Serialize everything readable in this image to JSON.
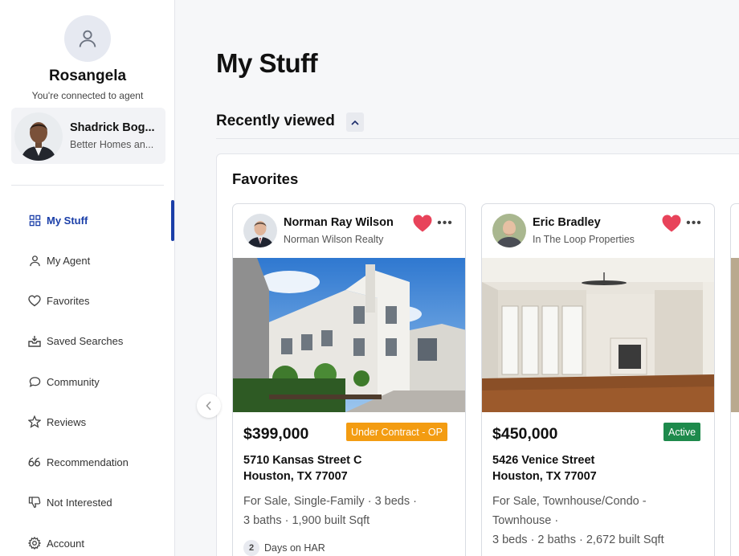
{
  "sidebar": {
    "user_name": "Rosangela",
    "connected_text": "You're connected to agent",
    "agent": {
      "name": "Shadrick Bog...",
      "company": "Better Homes an..."
    },
    "nav": [
      {
        "label": "My Stuff",
        "icon": "grid-icon",
        "active": true
      },
      {
        "label": "My Agent",
        "icon": "user-icon"
      },
      {
        "label": "Favorites",
        "icon": "heart-outline-icon"
      },
      {
        "label": "Saved Searches",
        "icon": "inbox-icon"
      },
      {
        "label": "Community",
        "icon": "chat-icon"
      },
      {
        "label": "Reviews",
        "icon": "star-icon"
      },
      {
        "label": "Recommendation",
        "icon": "quote-icon"
      },
      {
        "label": "Not Interested",
        "icon": "thumbs-down-icon"
      },
      {
        "label": "Account",
        "icon": "gear-icon"
      }
    ]
  },
  "main": {
    "page_title": "My Stuff",
    "recently_viewed_label": "Recently viewed",
    "favorites_title": "Favorites",
    "cards": [
      {
        "agent_name": "Norman Ray Wilson",
        "agent_company": "Norman Wilson Realty",
        "price": "$399,000",
        "status": "Under Contract - OP",
        "status_color": "#f39c12",
        "address_line1": "5710 Kansas Street C",
        "address_line2": "Houston, TX 77007",
        "details_line1": "For Sale, Single-Family  ·  3 beds  ·",
        "details_line2": "3 baths  ·  1,900 built Sqft",
        "days_on_har": "2",
        "days_label": "Days on HAR"
      },
      {
        "agent_name": "Eric Bradley",
        "agent_company": "In The Loop Properties",
        "price": "$450,000",
        "status": "Active",
        "status_color": "#1e8a4c",
        "address_line1": "5426 Venice Street",
        "address_line2": "Houston, TX 77007",
        "details_line1": "For Sale, Townhouse/Condo -",
        "details_line2": "Townhouse  ·",
        "details_line3": "3 beds  ·  2 baths  ·  2,672 built Sqft"
      }
    ]
  },
  "colors": {
    "accent": "#1a3ea8",
    "heart": "#e8435a"
  }
}
